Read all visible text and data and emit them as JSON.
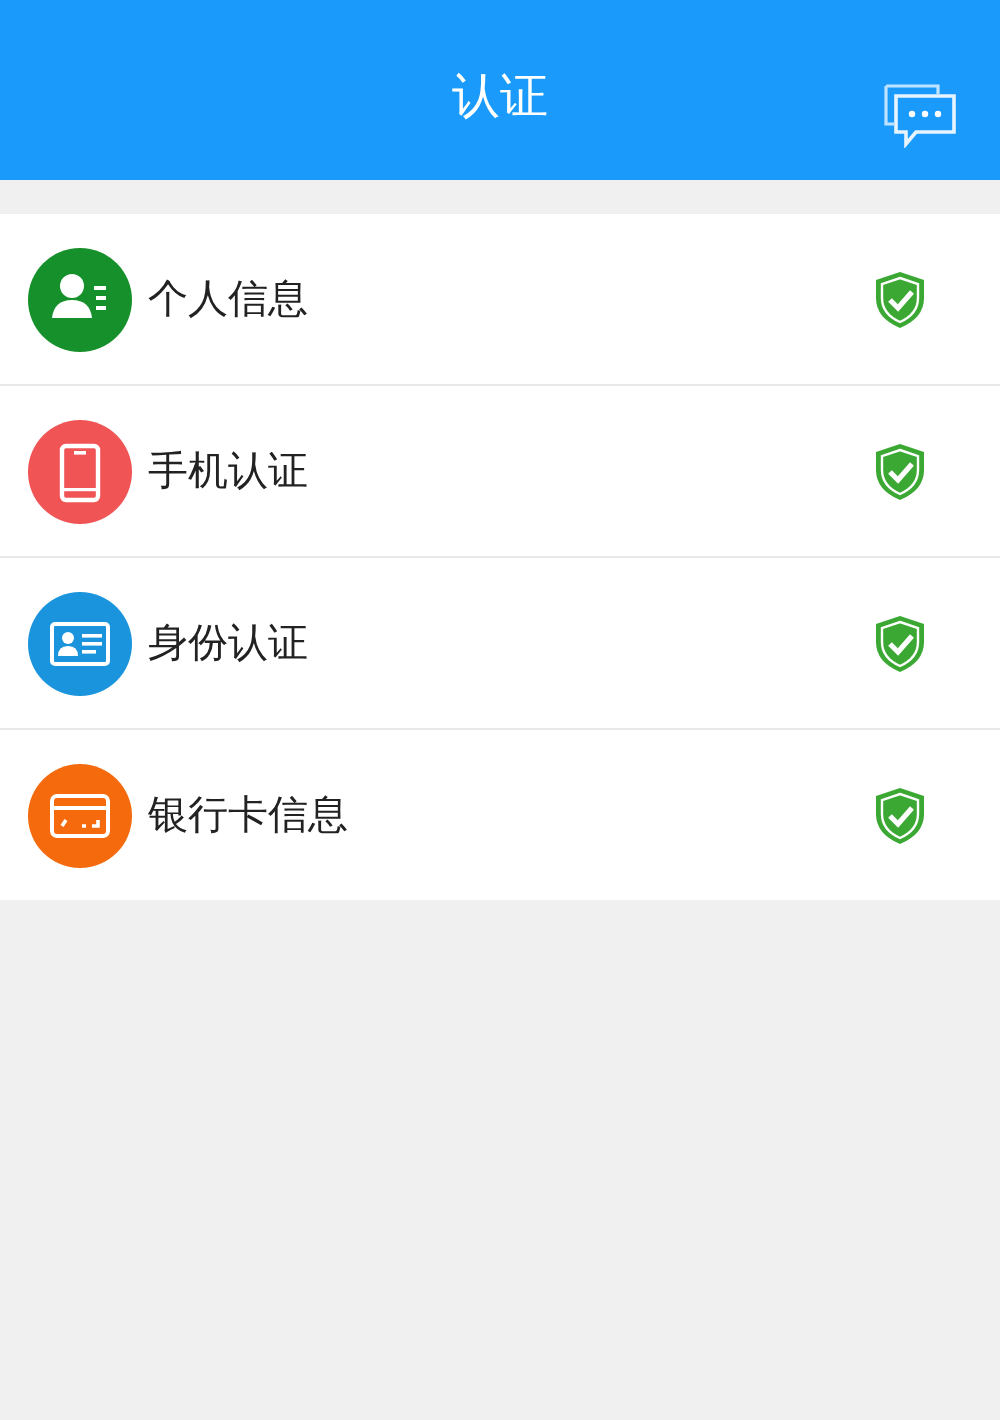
{
  "header": {
    "title": "认证"
  },
  "items": [
    {
      "label": "个人信息",
      "kind": "person",
      "color": "#16902a",
      "verified": true
    },
    {
      "label": "手机认证",
      "kind": "phone",
      "color": "#f05454",
      "verified": true
    },
    {
      "label": "身份认证",
      "kind": "idcard",
      "color": "#1a94dc",
      "verified": true
    },
    {
      "label": "银行卡信息",
      "kind": "bankcard",
      "color": "#f56a0c",
      "verified": true
    }
  ]
}
